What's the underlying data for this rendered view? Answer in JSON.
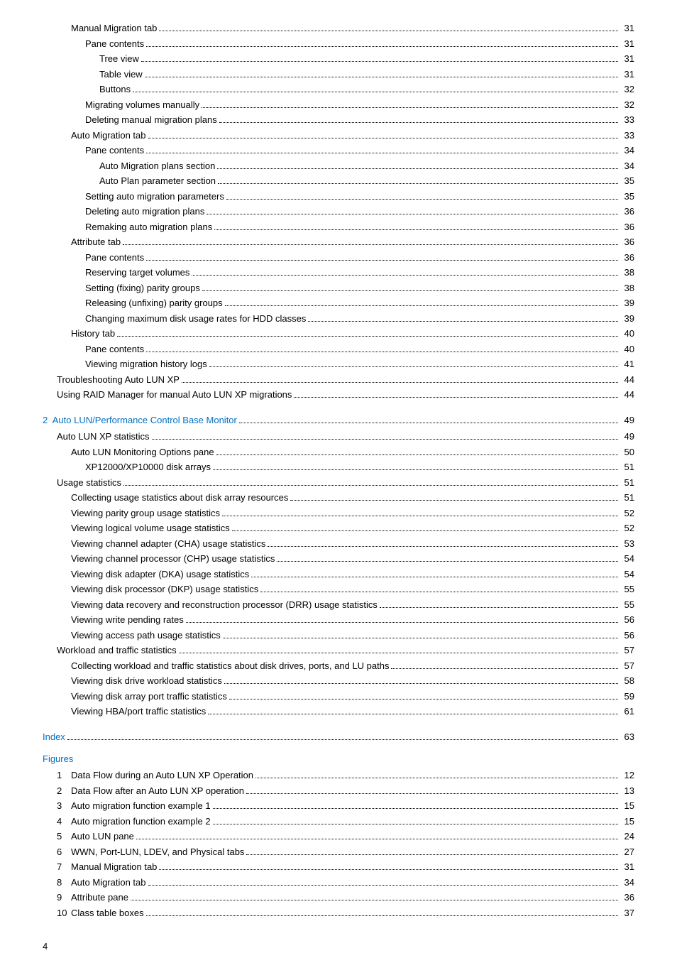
{
  "toc": {
    "entries": [
      {
        "label": "Manual Migration tab",
        "dots": true,
        "page": "31",
        "indent": 2
      },
      {
        "label": "Pane contents",
        "dots": true,
        "page": "31",
        "indent": 3
      },
      {
        "label": "Tree view",
        "dots": true,
        "page": "31",
        "indent": 4
      },
      {
        "label": "Table view",
        "dots": true,
        "page": "31",
        "indent": 4
      },
      {
        "label": "Buttons",
        "dots": true,
        "page": "32",
        "indent": 4
      },
      {
        "label": "Migrating volumes manually",
        "dots": true,
        "page": "32",
        "indent": 3
      },
      {
        "label": "Deleting manual migration plans",
        "dots": true,
        "page": "33",
        "indent": 3
      },
      {
        "label": "Auto Migration tab",
        "dots": true,
        "page": "33",
        "indent": 2
      },
      {
        "label": "Pane contents",
        "dots": true,
        "page": "34",
        "indent": 3
      },
      {
        "label": "Auto Migration plans section",
        "dots": true,
        "page": "34",
        "indent": 4
      },
      {
        "label": "Auto Plan parameter section",
        "dots": true,
        "page": "35",
        "indent": 4
      },
      {
        "label": "Setting auto migration parameters",
        "dots": true,
        "page": "35",
        "indent": 3
      },
      {
        "label": "Deleting auto migration plans",
        "dots": true,
        "page": "36",
        "indent": 3
      },
      {
        "label": "Remaking auto migration plans",
        "dots": true,
        "page": "36",
        "indent": 3
      },
      {
        "label": "Attribute tab",
        "dots": true,
        "page": "36",
        "indent": 2
      },
      {
        "label": "Pane contents",
        "dots": true,
        "page": "36",
        "indent": 3
      },
      {
        "label": "Reserving target volumes",
        "dots": true,
        "page": "38",
        "indent": 3
      },
      {
        "label": "Setting (fixing) parity groups",
        "dots": true,
        "page": "38",
        "indent": 3
      },
      {
        "label": "Releasing (unfixing) parity groups",
        "dots": true,
        "page": "39",
        "indent": 3
      },
      {
        "label": "Changing maximum disk usage rates for HDD classes",
        "dots": true,
        "page": "39",
        "indent": 3
      },
      {
        "label": "History tab",
        "dots": true,
        "page": "40",
        "indent": 2
      },
      {
        "label": "Pane contents",
        "dots": true,
        "page": "40",
        "indent": 3
      },
      {
        "label": "Viewing migration history logs",
        "dots": true,
        "page": "41",
        "indent": 3
      },
      {
        "label": "Troubleshooting Auto LUN XP",
        "dots": true,
        "page": "44",
        "indent": 1
      },
      {
        "label": "Using RAID Manager for manual Auto LUN XP migrations",
        "dots": true,
        "page": "44",
        "indent": 1
      }
    ],
    "section2": {
      "number": "2",
      "label": "Auto LUN/Performance Control Base Monitor",
      "page": "49",
      "subentries": [
        {
          "label": "Auto LUN XP statistics",
          "dots": true,
          "page": "49",
          "indent": 1
        },
        {
          "label": "Auto LUN Monitoring Options pane",
          "dots": true,
          "page": "50",
          "indent": 2
        },
        {
          "label": "XP12000/XP10000 disk arrays",
          "dots": true,
          "page": "51",
          "indent": 3
        },
        {
          "label": "Usage statistics",
          "dots": true,
          "page": "51",
          "indent": 1
        },
        {
          "label": "Collecting usage statistics about disk array resources",
          "dots": true,
          "page": "51",
          "indent": 2
        },
        {
          "label": "Viewing parity group usage statistics",
          "dots": true,
          "page": "52",
          "indent": 2
        },
        {
          "label": "Viewing logical volume usage statistics",
          "dots": true,
          "page": "52",
          "indent": 2
        },
        {
          "label": "Viewing channel adapter (CHA) usage statistics",
          "dots": true,
          "page": "53",
          "indent": 2
        },
        {
          "label": "Viewing channel processor (CHP) usage statistics",
          "dots": true,
          "page": "54",
          "indent": 2
        },
        {
          "label": "Viewing disk adapter (DKA) usage statistics",
          "dots": true,
          "page": "54",
          "indent": 2
        },
        {
          "label": "Viewing disk processor (DKP) usage statistics",
          "dots": true,
          "page": "55",
          "indent": 2
        },
        {
          "label": "Viewing data recovery and reconstruction processor (DRR) usage statistics",
          "dots": true,
          "page": "55",
          "indent": 2
        },
        {
          "label": "Viewing write pending rates",
          "dots": true,
          "page": "56",
          "indent": 2
        },
        {
          "label": "Viewing access path usage statistics",
          "dots": true,
          "page": "56",
          "indent": 2
        },
        {
          "label": "Workload and traffic statistics",
          "dots": true,
          "page": "57",
          "indent": 1
        },
        {
          "label": "Collecting workload and traffic statistics about disk drives, ports, and LU paths",
          "dots": true,
          "page": "57",
          "indent": 2
        },
        {
          "label": "Viewing disk drive workload statistics",
          "dots": true,
          "page": "58",
          "indent": 2
        },
        {
          "label": "Viewing disk array port traffic statistics",
          "dots": true,
          "page": "59",
          "indent": 2
        },
        {
          "label": "Viewing HBA/port traffic statistics",
          "dots": true,
          "page": "61",
          "indent": 2
        }
      ]
    },
    "index": {
      "label": "Index",
      "page": "63"
    },
    "figures": {
      "heading": "Figures",
      "items": [
        {
          "number": "1",
          "label": "Data Flow during an Auto LUN XP Operation",
          "dots": true,
          "page": "12"
        },
        {
          "number": "2",
          "label": "Data Flow after an Auto LUN XP operation",
          "dots": true,
          "page": "13"
        },
        {
          "number": "3",
          "label": "Auto migration function example 1",
          "dots": true,
          "page": "15"
        },
        {
          "number": "4",
          "label": "Auto migration function example 2",
          "dots": true,
          "page": "15"
        },
        {
          "number": "5",
          "label": "Auto LUN pane",
          "dots": true,
          "page": "24"
        },
        {
          "number": "6",
          "label": "WWN, Port-LUN, LDEV, and Physical tabs",
          "dots": true,
          "page": "27"
        },
        {
          "number": "7",
          "label": "Manual Migration tab",
          "dots": true,
          "page": "31"
        },
        {
          "number": "8",
          "label": "Auto Migration tab",
          "dots": true,
          "page": "34"
        },
        {
          "number": "9",
          "label": "Attribute pane",
          "dots": true,
          "page": "36"
        },
        {
          "number": "10",
          "label": "Class table boxes",
          "dots": true,
          "page": "37"
        }
      ]
    }
  },
  "page_num": "4"
}
